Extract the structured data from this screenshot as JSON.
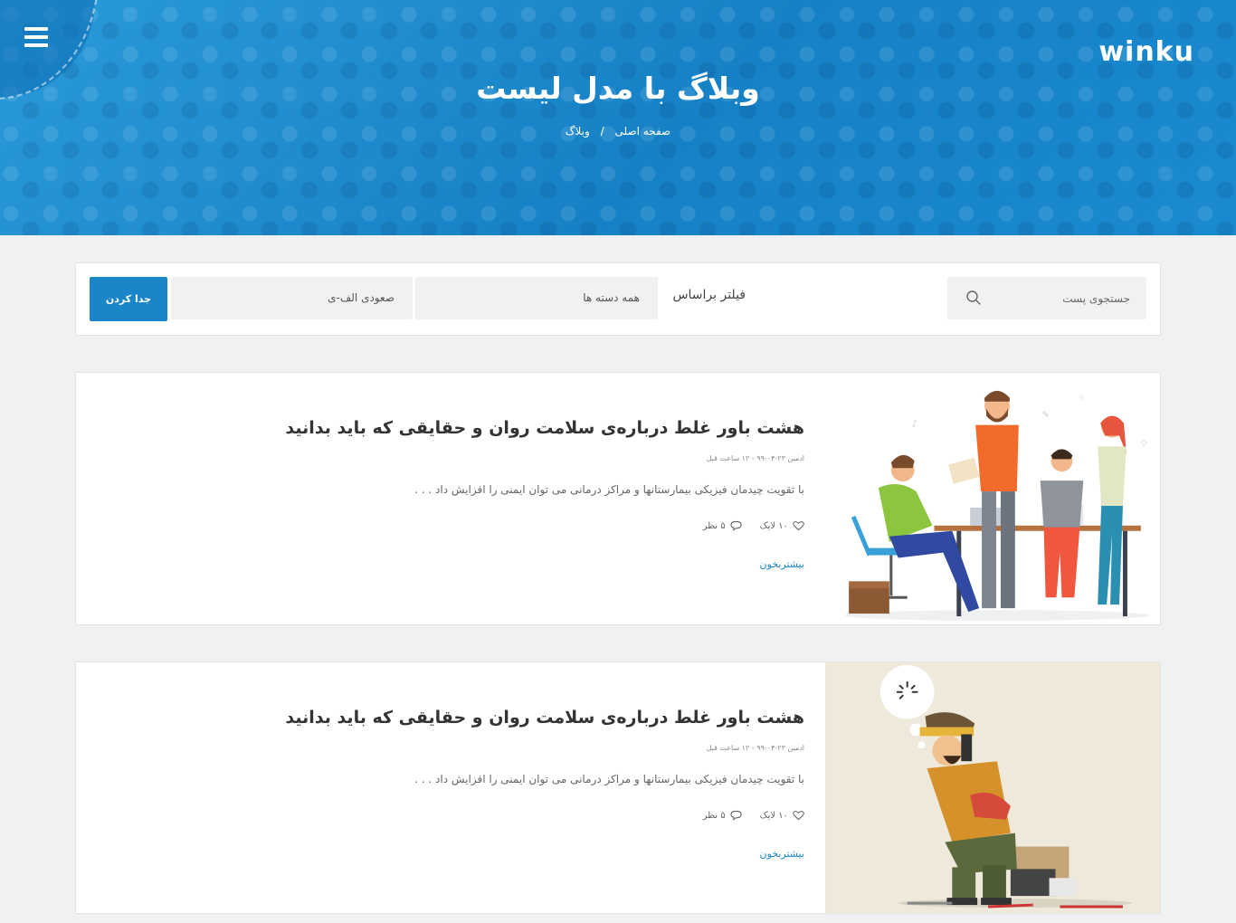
{
  "header": {
    "logo": "winku",
    "title": "وبلاگ با مدل لیست",
    "breadcrumb": {
      "home": "صفحه اصلی",
      "separator": "/",
      "current": "وبلاگ"
    }
  },
  "filter": {
    "search_placeholder": "جستجوی پست",
    "filter_label": "فیلتر براساس",
    "category_select": "همه دسته ها",
    "order_select": "صعودی الف-ی",
    "apply_button": "جدا کردن"
  },
  "posts": [
    {
      "title": "هشت باور غلط درباره‌ی سلامت روان و حقایقی که باید بدانید",
      "meta": "ادمین ۲۳-۰۴-۹۹ - ۱۲ ساعت قبل",
      "excerpt": "با تقویت چیدمان فیزیکی بیمارستانها و مراکز درمانی می توان ایمنی را افزایش داد . . .",
      "likes": "۱۰ لایک",
      "comments": "۵ نظر",
      "read_more": "بیشتربخون",
      "image": "team-working-illustration"
    },
    {
      "title": "هشت باور غلط درباره‌ی سلامت روان و حقایقی که باید بدانید",
      "meta": "ادمین ۲۳-۰۴-۹۹ - ۱۲ ساعت قبل",
      "excerpt": "با تقویت چیدمان فیزیکی بیمارستانها و مراکز درمانی می توان ایمنی را افزایش داد . . .",
      "likes": "۱۰ لایک",
      "comments": "۵ نظر",
      "read_more": "بیشتربخون",
      "image": "tired-worker-illustration"
    }
  ],
  "colors": {
    "accent": "#1a86c9",
    "hero": "#1c8bd0",
    "page_bg": "#f1f0f2"
  }
}
